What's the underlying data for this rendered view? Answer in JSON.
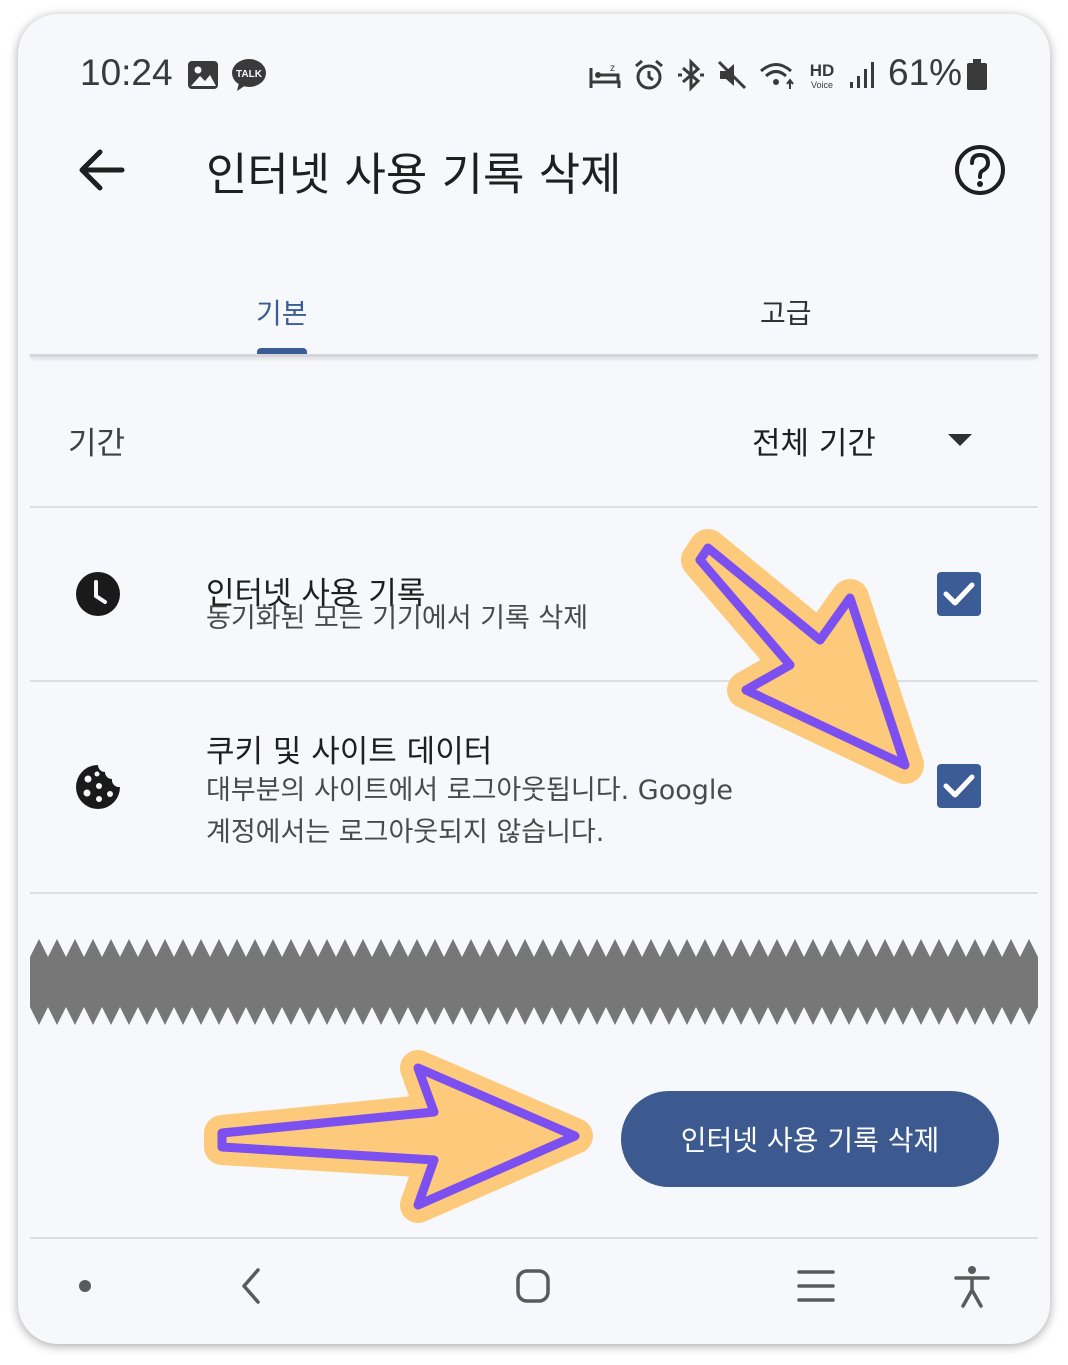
{
  "status_bar": {
    "time": "10:24",
    "talk_badge": "TALK",
    "hd_label": "HD",
    "voice_label": "Voice",
    "battery_percent": "61%",
    "icons": [
      "gallery-icon",
      "kakaotalk-icon",
      "sleep-icon",
      "alarm-icon",
      "bluetooth-icon",
      "mute-icon",
      "wifi-icon",
      "hd-voice-icon",
      "signal-icon",
      "battery-icon"
    ]
  },
  "app_bar": {
    "title": "인터넷 사용 기록 삭제",
    "back_icon": "arrow-left-icon",
    "help_icon": "help-circle-icon"
  },
  "tabs": [
    {
      "label": "기본",
      "selected": true
    },
    {
      "label": "고급",
      "selected": false
    }
  ],
  "period": {
    "label": "기간",
    "value": "전체 기간"
  },
  "options": [
    {
      "icon": "clock-icon",
      "title": "인터넷 사용 기록",
      "subtitle": "동기화된 모든 기기에서 기록 삭제",
      "checked": true
    },
    {
      "icon": "cookie-icon",
      "title": "쿠키 및 사이트 데이터",
      "subtitle_line1": "대부분의 사이트에서 로그아웃됩니다. Google",
      "subtitle_line2": "계정에서는 로그아웃되지 않습니다.",
      "checked": true
    }
  ],
  "delete_button": {
    "label": "인터넷 사용 기록 삭제"
  },
  "nav_bar": {
    "icons": [
      "dot-icon",
      "nav-back-icon",
      "home-icon",
      "recents-icon",
      "accessibility-icon"
    ]
  },
  "colors": {
    "accent": "#3b5c96",
    "button": "#3c5a8f",
    "background": "#f7f8fc",
    "annotation_fill": "#fdc97a",
    "annotation_stroke": "#7b4ff0"
  }
}
